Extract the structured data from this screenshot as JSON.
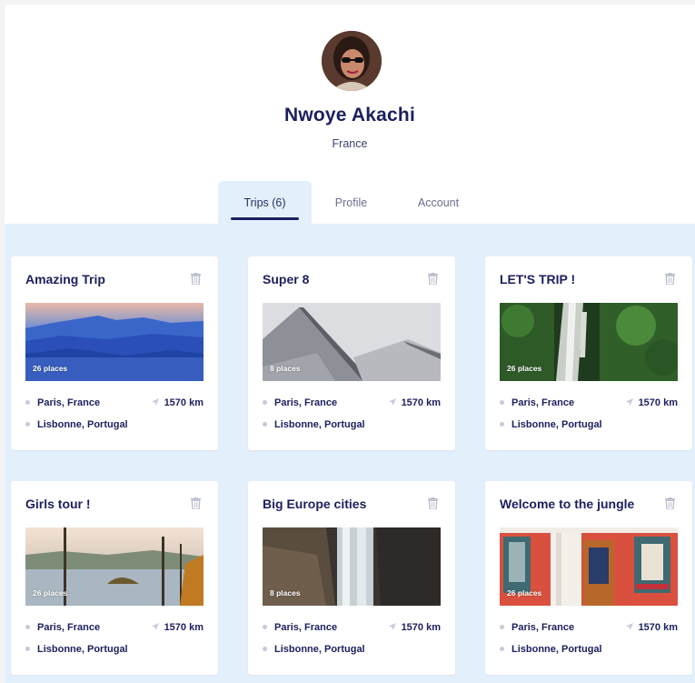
{
  "profile": {
    "name": "Nwoye Akachi",
    "country": "France"
  },
  "tabs": [
    {
      "label": "Trips (6)",
      "active": true
    },
    {
      "label": "Profile",
      "active": false
    },
    {
      "label": "Account",
      "active": false
    }
  ],
  "colors": {
    "navy": "#1c1f5e",
    "light_blue_bg": "#e4effc",
    "muted_text": "#6b6e8f"
  },
  "trips": [
    {
      "title": "Amazing Trip",
      "places": "26 places",
      "from": "Paris, France",
      "to": "Lisbonne, Portugal",
      "distance": "1570 km",
      "image": "blue-mountains"
    },
    {
      "title": "Super 8",
      "places": "8 places",
      "from": "Paris, France",
      "to": "Lisbonne, Portugal",
      "distance": "1570 km",
      "image": "architecture"
    },
    {
      "title": "LET'S TRIP !",
      "places": "26 places",
      "from": "Paris, France",
      "to": "Lisbonne, Portugal",
      "distance": "1570 km",
      "image": "jungle-waterfall"
    },
    {
      "title": "Girls tour !",
      "places": "26 places",
      "from": "Paris, France",
      "to": "Lisbonne, Portugal",
      "distance": "1570 km",
      "image": "lake"
    },
    {
      "title": "Big Europe cities",
      "places": "8 places",
      "from": "Paris, France",
      "to": "Lisbonne, Portugal",
      "distance": "1570 km",
      "image": "waterfall"
    },
    {
      "title": "Welcome to the jungle",
      "places": "26 places",
      "from": "Paris, France",
      "to": "Lisbonne, Portugal",
      "distance": "1570 km",
      "image": "windows"
    }
  ]
}
